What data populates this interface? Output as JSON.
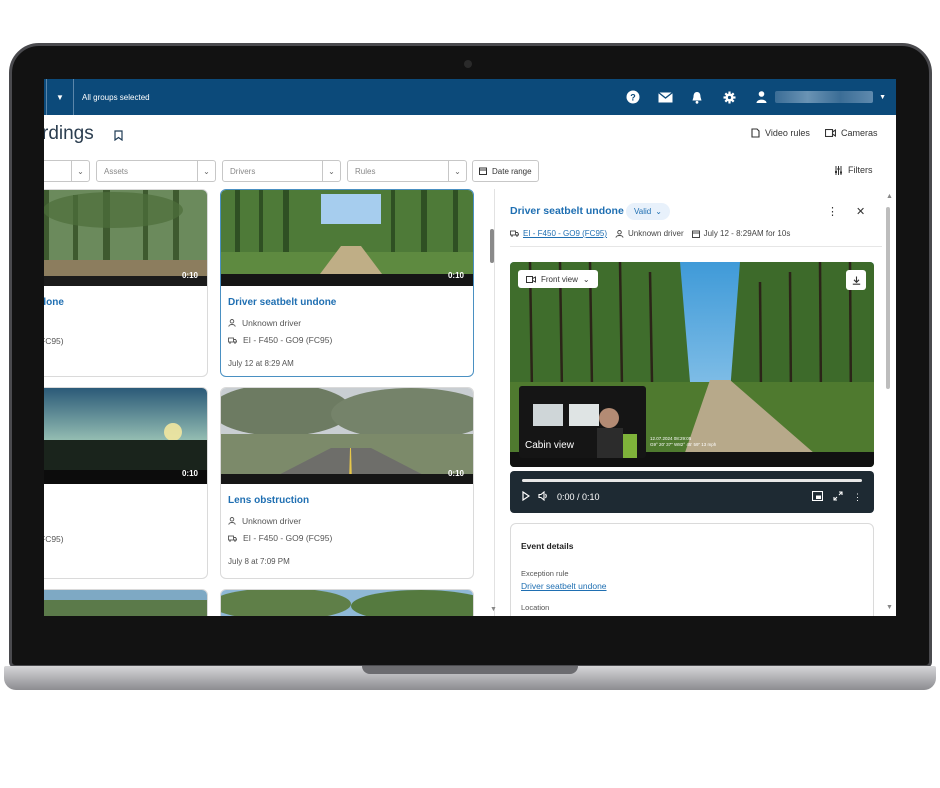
{
  "topbar": {
    "groups_text": "All groups selected"
  },
  "header": {
    "title": "rdings",
    "video_rules": "Video rules",
    "cameras": "Cameras"
  },
  "filters": {
    "assets": "Assets",
    "drivers": "Drivers",
    "rules": "Rules",
    "date_range": "Date range",
    "filters_label": "Filters"
  },
  "cards": [
    {
      "duration": "0:10",
      "title": "done",
      "vehicle": "FC95)"
    },
    {
      "duration": "0:10",
      "title": "Driver seatbelt undone",
      "driver": "Unknown driver",
      "vehicle": "EI - F450 - GO9 (FC95)",
      "date": "July 12 at 8:29 AM"
    },
    {
      "duration": "0:10",
      "vehicle": "FC95)"
    },
    {
      "duration": "0:10",
      "title": "Lens obstruction",
      "driver": "Unknown driver",
      "vehicle": "EI - F450 - GO9 (FC95)",
      "date": "July 8 at 7:09 PM"
    }
  ],
  "detail": {
    "title": "Driver seatbelt undone",
    "status": "Valid",
    "vehicle": "EI - F450 - GO9 (FC95)",
    "driver": "Unknown driver",
    "datetime": "July 12 - 8:29AM for 10s",
    "view_select": "Front view",
    "cabin_label": "Cabin view",
    "stamp_line1": "12.07.2024 08:29:05",
    "stamp_line2": "G9° 20' 37\" W82° 45' 59\" 13 mph",
    "time": "0:00 / 0:10",
    "progress": 0.0,
    "event_details": "Event details",
    "exception_rule_label": "Exception rule",
    "exception_rule_value": "Driver seatbelt undone",
    "location_label": "Location"
  },
  "colors": {
    "topbar": "#0c4a7a",
    "link": "#1f6fb2"
  }
}
